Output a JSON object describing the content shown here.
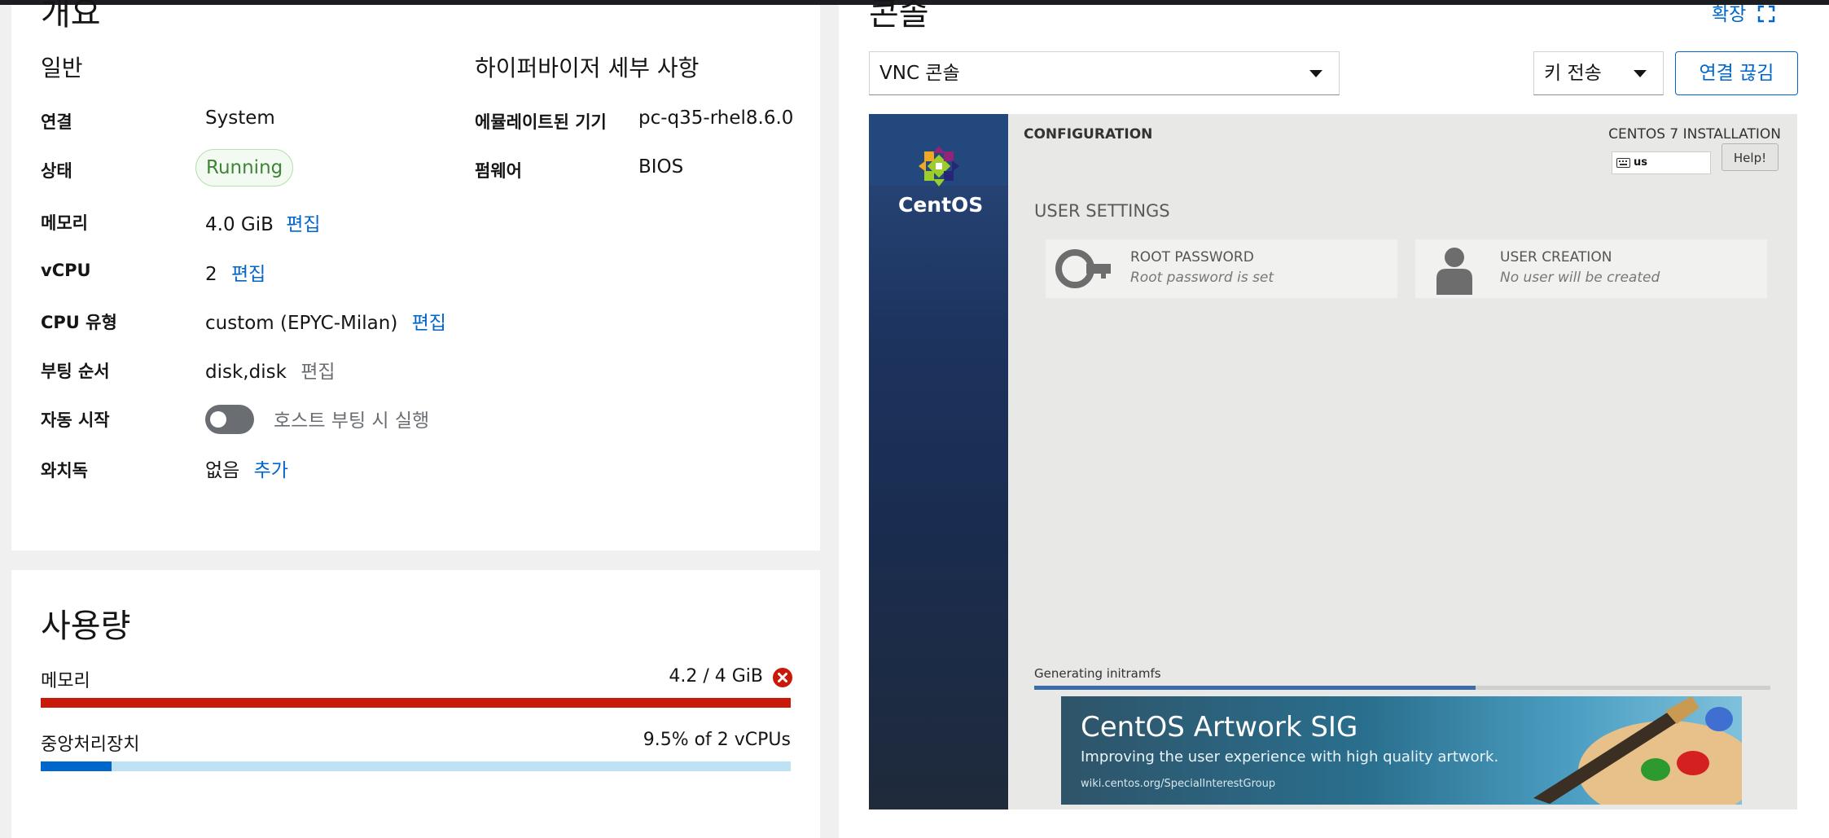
{
  "overview": {
    "title": "개요",
    "general_title": "일반",
    "rows": [
      {
        "label": "연결",
        "value": "System"
      },
      {
        "label": "상태",
        "value": "Running"
      },
      {
        "label": "메모리",
        "value": "4.0 GiB",
        "action": "편집"
      },
      {
        "label": "vCPU",
        "value": "2",
        "action": "편집"
      },
      {
        "label": "CPU 유형",
        "value": "custom (EPYC-Milan)",
        "action": "편집"
      },
      {
        "label": "부팅 순서",
        "value": "disk,disk",
        "action": "편집"
      },
      {
        "label": "자동 시작",
        "value": "호스트 부팅 시 실행",
        "toggle_on": false
      },
      {
        "label": "와치독",
        "value": "없음",
        "action": "추가"
      }
    ],
    "hypervisor_title": "하이퍼바이저 세부 사항",
    "hv_rows": [
      {
        "label": "에뮬레이트된 기기",
        "value": "pc-q35-rhel8.6.0"
      },
      {
        "label": "펌웨어",
        "value": "BIOS"
      }
    ]
  },
  "usage": {
    "title": "사용량",
    "memory": {
      "label": "메모리",
      "value": "4.2 / 4 GiB",
      "fraction": 1.0,
      "color": "#c9190b"
    },
    "cpu": {
      "label": "중앙처리장치",
      "value": "9.5% of 2 vCPUs",
      "fraction": 0.095,
      "color": "#0066cc"
    }
  },
  "console": {
    "title": "콘솔",
    "expand_label": "확장",
    "type_select": "VNC 콘솔",
    "send_key": "키 전송",
    "disconnect": "연결 끊김",
    "vnc": {
      "logo_text": "CentOS",
      "section": "CONFIGURATION",
      "install_title": "CENTOS 7 INSTALLATION",
      "keyboard": "us",
      "help": "Help!",
      "user_settings": "USER SETTINGS",
      "root_title": "ROOT PASSWORD",
      "root_sub": "Root password is set",
      "user_title": "USER CREATION",
      "user_sub": "No user will be created",
      "progress_text": "Generating initramfs",
      "progress_fraction": 0.6,
      "banner_title": "CentOS Artwork SIG",
      "banner_sub": "Improving the user experience with high quality artwork.",
      "banner_url": "wiki.centos.org/SpecialInterestGroup"
    }
  }
}
